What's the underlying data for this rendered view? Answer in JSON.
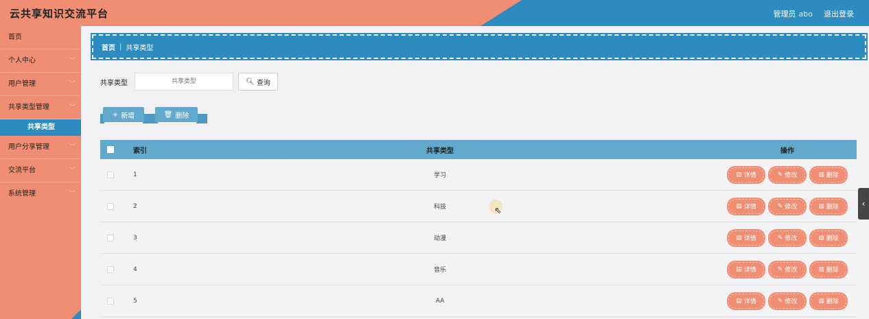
{
  "header": {
    "title": "云共享知识交流平台",
    "role_label": "管理员",
    "username": "abo",
    "logout_label": "退出登录"
  },
  "sidebar": {
    "items": [
      {
        "label": "首页",
        "has_chevron": false
      },
      {
        "label": "个人中心",
        "has_chevron": true
      },
      {
        "label": "用户管理",
        "has_chevron": true
      },
      {
        "label": "共享类型管理",
        "has_chevron": true
      },
      {
        "label": "用户分享管理",
        "has_chevron": true
      },
      {
        "label": "交流平台",
        "has_chevron": true
      },
      {
        "label": "系统管理",
        "has_chevron": true
      }
    ],
    "active_sub": "共享类型"
  },
  "breadcrumb": {
    "home": "首页",
    "separator": "|",
    "current": "共享类型"
  },
  "search": {
    "label": "共享类型",
    "placeholder": "共享类型",
    "button_label": "查询"
  },
  "actions": {
    "add_label": "新增",
    "delete_label": "删除"
  },
  "table": {
    "headers": {
      "index": "索引",
      "type": "共享类型",
      "ops": "操作"
    },
    "rows": [
      {
        "index": "1",
        "type": "学习"
      },
      {
        "index": "2",
        "type": "科技"
      },
      {
        "index": "3",
        "type": "动漫"
      },
      {
        "index": "4",
        "type": "音乐"
      },
      {
        "index": "5",
        "type": "AA"
      }
    ],
    "row_buttons": {
      "detail": "详情",
      "edit": "修改",
      "delete": "删除"
    }
  },
  "colors": {
    "accent_orange": "#f08e73",
    "accent_blue": "#2d8cbf",
    "table_header": "#63a9cc"
  }
}
